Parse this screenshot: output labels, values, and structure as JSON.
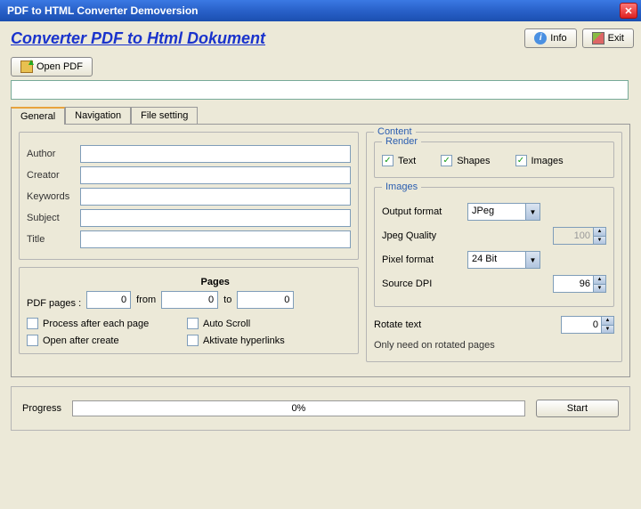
{
  "window": {
    "title": "PDF to HTML Converter  Demoversion"
  },
  "header": {
    "heading": "Converter PDF to  Html Dokument",
    "info_btn": "Info",
    "exit_btn": "Exit"
  },
  "open": {
    "button": "Open PDF",
    "path": ""
  },
  "tabs": {
    "general": "General",
    "navigation": "Navigation",
    "file_setting": "File setting"
  },
  "meta": {
    "author_label": "Author",
    "author": "",
    "creator_label": "Creator",
    "creator": "",
    "keywords_label": "Keywords",
    "keywords": "",
    "subject_label": "Subject",
    "subject": "",
    "title_label": "Title",
    "title": ""
  },
  "pages": {
    "pdf_pages_label": "PDF pages :",
    "pdf_pages": "0",
    "heading": "Pages",
    "from_label": "from",
    "from": "0",
    "to_label": "to",
    "to": "0",
    "process_each": "Process after each page",
    "auto_scroll": "Auto Scroll",
    "open_after": "Open after create",
    "activate_links": "Aktivate hyperlinks"
  },
  "content": {
    "group": "Content",
    "render_group": "Render",
    "text": "Text",
    "shapes": "Shapes",
    "images_cb": "Images",
    "images_group": "Images",
    "output_format_label": "Output format",
    "output_format": "JPeg",
    "jpeg_quality_label": "Jpeg Quality",
    "jpeg_quality": "100",
    "pixel_format_label": "Pixel format",
    "pixel_format": "24 Bit",
    "source_dpi_label": "Source DPI",
    "source_dpi": "96",
    "rotate_text_label": "Rotate text",
    "rotate_text": "0",
    "note": "Only need on rotated pages"
  },
  "progress": {
    "label": "Progress",
    "value": "0%",
    "start": "Start"
  }
}
